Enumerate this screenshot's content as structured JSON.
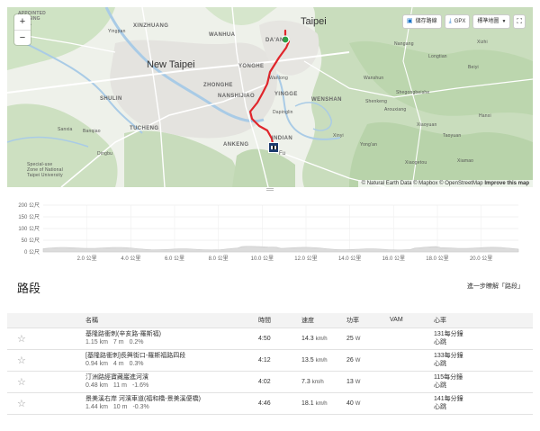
{
  "map": {
    "zoom_in": "+",
    "zoom_out": "−",
    "buttons": {
      "save_route": "儲存路線",
      "gpx": "GPX",
      "map_style": "標準地圖"
    },
    "attribution": {
      "text": "© Natural Earth Data © Mapbox © OpenStreetMap",
      "improve": "Improve this map"
    },
    "labels": {
      "taipei": "Taipei",
      "new_taipei": "New Taipei",
      "yingpan": "Yingpan",
      "xinzhuang": "XINZHUANG",
      "wanhua": "WANHUA",
      "daan": "DA'AN",
      "yonghe": "YONGHE",
      "zhonghe": "ZHONGHE",
      "nanshijiao": "NANSHIJIAO",
      "yingge": "YINGGE",
      "wenshan": "WENSHAN",
      "tucheng": "TUCHENG",
      "anfeng": "ANKENG",
      "indian": "INDIAN",
      "shulin": "SHULIN",
      "dingbu": "Dingbu",
      "wanlong": "Wanlong",
      "dapinglin": "Dapinglin",
      "banqiao": "Banqiao",
      "sanxia": "Sanxia",
      "special_zone": "Special-use\nZone of National\nTaipei University",
      "fu": "Fu",
      "wanshun": "Wanshun",
      "shenkeng": "Shenkeng",
      "shegongbeishe": "Shegongbeishe",
      "arouxiang": "Arouxiang",
      "xinyi": "Xinyi",
      "yongan": "Yong'an",
      "xiaoyuan": "Xiaoyuan",
      "xiaogetou": "Xiaogetou",
      "taoyuan": "Taoyuan",
      "hanxi": "Hanxi",
      "nangang": "Nangang",
      "longtian": "Longtian",
      "beiyi": "Beiyi",
      "xiamao": "Xiamao",
      "xizhi": "Xizhi",
      "appoint": "APPOINTED\nHOUSING\nAREA"
    }
  },
  "elevation": {
    "y_ticks": [
      "200 公尺",
      "150 公尺",
      "100 公尺",
      "50 公尺",
      "0 公尺"
    ],
    "x_ticks": [
      "2.0 公里",
      "4.0 公里",
      "6.0 公里",
      "8.0 公里",
      "10.0 公里",
      "12.0 公里",
      "14.0 公里",
      "16.0 公里",
      "18.0 公里",
      "20.0 公里"
    ]
  },
  "segments": {
    "title": "路段",
    "more_link": "進一步瞭解「路段」",
    "columns": {
      "name": "名稱",
      "time": "時間",
      "speed": "速度",
      "power": "功率",
      "vam": "VAM",
      "hr": "心率"
    },
    "rows": [
      {
        "name": "基隆路衝刺(辛亥路-羅斯福)",
        "distance": "1.15 km",
        "elev": "7 m",
        "grade": "0.2%",
        "time": "4:50",
        "speed": "14.3",
        "speed_unit": "km/h",
        "power": "25",
        "power_unit": "W",
        "hr": "131每分鐘",
        "hr_unit": "心跳"
      },
      {
        "name": "[基隆路衝刺]長興街口-羅斯福路四段",
        "distance": "0.94 km",
        "elev": "4 m",
        "grade": "0.3%",
        "time": "4:12",
        "speed": "13.5",
        "speed_unit": "km/h",
        "power": "26",
        "power_unit": "W",
        "hr": "133每分鐘",
        "hr_unit": "心跳"
      },
      {
        "name": "汀洲路經寶藏巖進河濱",
        "distance": "0.48 km",
        "elev": "11 m",
        "grade": "-1.6%",
        "time": "4:02",
        "speed": "7.3",
        "speed_unit": "km/h",
        "power": "13",
        "power_unit": "W",
        "hr": "115每分鐘",
        "hr_unit": "心跳"
      },
      {
        "name": "景美溪右岸 河濱車道(福和橋-景美溪便橋)",
        "distance": "1.44 km",
        "elev": "10 m",
        "grade": "-0.3%",
        "time": "4:46",
        "speed": "18.1",
        "speed_unit": "km/h",
        "power": "40",
        "power_unit": "W",
        "hr": "141每分鐘",
        "hr_unit": "心跳"
      }
    ]
  },
  "colors": {
    "route": "#e0252b",
    "start": "#2ea043",
    "elevation_fill": "#dcdcdc",
    "link": "#1a73c8"
  }
}
